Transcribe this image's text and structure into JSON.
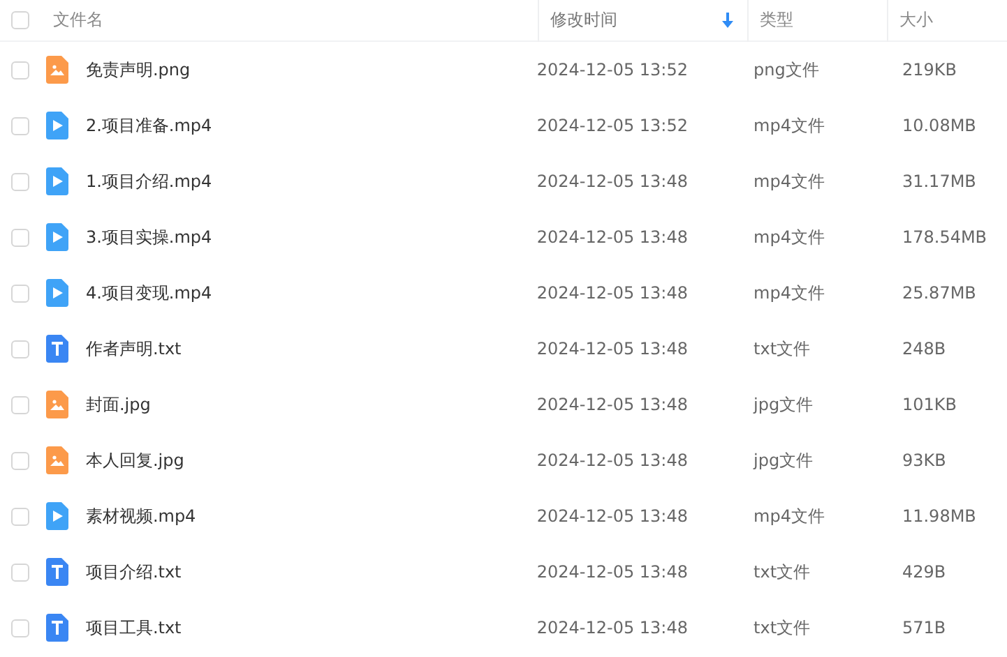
{
  "header": {
    "checked": false,
    "columns": [
      {
        "label": "文件名",
        "sorted": false
      },
      {
        "label": "修改时间",
        "sorted": true
      },
      {
        "label": "类型",
        "sorted": false
      },
      {
        "label": "大小",
        "sorted": false
      }
    ]
  },
  "rows": [
    {
      "checked": false,
      "kind": "image",
      "name": "免责声明.png",
      "time": "2024-12-05 13:52",
      "type": "png文件",
      "size": "219KB"
    },
    {
      "checked": false,
      "kind": "video",
      "name": "2.项目准备.mp4",
      "time": "2024-12-05 13:52",
      "type": "mp4文件",
      "size": "10.08MB"
    },
    {
      "checked": false,
      "kind": "video",
      "name": "1.项目介绍.mp4",
      "time": "2024-12-05 13:48",
      "type": "mp4文件",
      "size": "31.17MB"
    },
    {
      "checked": false,
      "kind": "video",
      "name": "3.项目实操.mp4",
      "time": "2024-12-05 13:48",
      "type": "mp4文件",
      "size": "178.54MB"
    },
    {
      "checked": false,
      "kind": "video",
      "name": "4.项目变现.mp4",
      "time": "2024-12-05 13:48",
      "type": "mp4文件",
      "size": "25.87MB"
    },
    {
      "checked": false,
      "kind": "text",
      "name": "作者声明.txt",
      "time": "2024-12-05 13:48",
      "type": "txt文件",
      "size": "248B"
    },
    {
      "checked": false,
      "kind": "image",
      "name": "封面.jpg",
      "time": "2024-12-05 13:48",
      "type": "jpg文件",
      "size": "101KB"
    },
    {
      "checked": false,
      "kind": "image",
      "name": "本人回复.jpg",
      "time": "2024-12-05 13:48",
      "type": "jpg文件",
      "size": "93KB"
    },
    {
      "checked": false,
      "kind": "video",
      "name": "素材视频.mp4",
      "time": "2024-12-05 13:48",
      "type": "mp4文件",
      "size": "11.98MB"
    },
    {
      "checked": false,
      "kind": "text",
      "name": "项目介绍.txt",
      "time": "2024-12-05 13:48",
      "type": "txt文件",
      "size": "429B"
    },
    {
      "checked": false,
      "kind": "text",
      "name": "项目工具.txt",
      "time": "2024-12-05 13:48",
      "type": "txt文件",
      "size": "571B"
    }
  ]
}
